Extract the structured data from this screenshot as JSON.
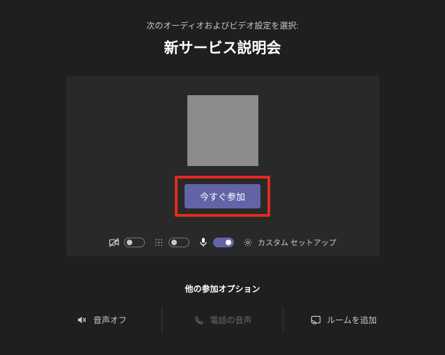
{
  "header": {
    "subtitle": "次のオーディオおよびビデオ設定を選択:",
    "title": "新サービス説明会"
  },
  "join": {
    "label": "今すぐ参加"
  },
  "controls": {
    "camera": {
      "on": false
    },
    "blur": {
      "on": false
    },
    "mic": {
      "on": true
    },
    "custom_setup": "カスタム セットアップ"
  },
  "other_options": {
    "heading": "他の参加オプション",
    "audio_off": "音声オフ",
    "phone_audio": "電話の音声",
    "add_room": "ルームを追加"
  }
}
